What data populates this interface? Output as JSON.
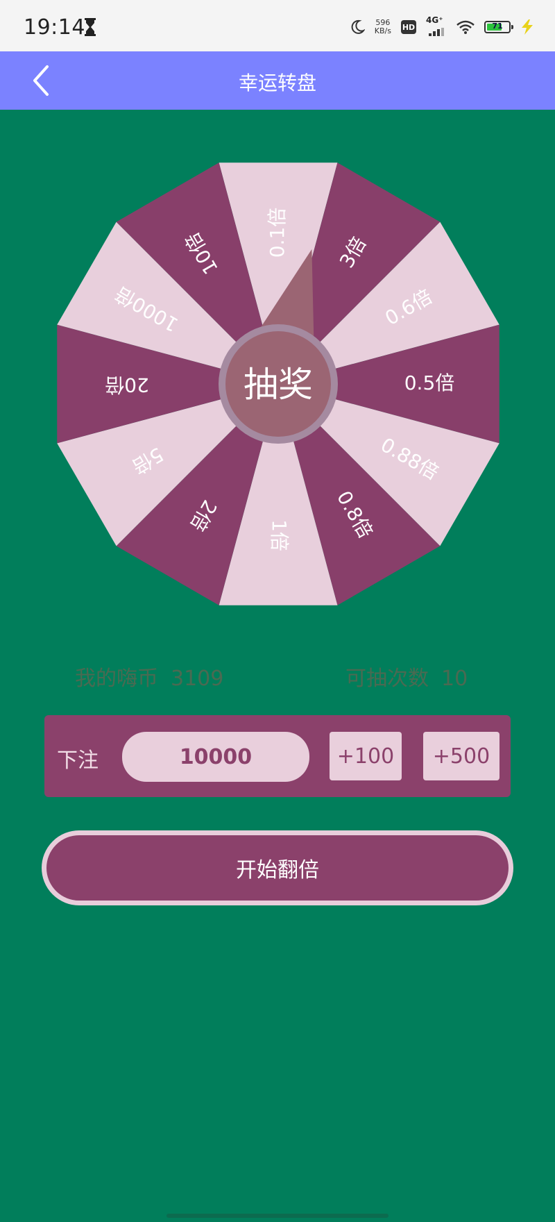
{
  "status_bar": {
    "time": "19:14",
    "net_speed_value": "596",
    "net_speed_unit": "KB/s",
    "hd": "HD",
    "network": "4G⁺",
    "battery": "71",
    "battery_level": 0.71
  },
  "header": {
    "title": "幸运转盘",
    "back_icon": "chevron-left-icon"
  },
  "wheel": {
    "segments": [
      "0.1倍",
      "3倍",
      "0.6倍",
      "0.5倍",
      "0.88倍",
      "0.8倍",
      "1倍",
      "2倍",
      "5倍",
      "20倍",
      "1000倍",
      "10倍"
    ],
    "center_label": "抽奖",
    "colors": {
      "dark": "#883f6a",
      "light": "#e8cfdc",
      "pointer": "#9b6573",
      "center": "#9b6573",
      "center_ring": "#a58aa0"
    }
  },
  "info": {
    "coins_label": "我的嗨币",
    "coins_value": "3109",
    "times_label": "可抽次数",
    "times_value": "10"
  },
  "bet": {
    "label": "下注",
    "value": "10000",
    "add_100": "+100",
    "add_500": "+500"
  },
  "start_button": "开始翻倍",
  "colors": {
    "background": "#017e5b",
    "header": "#7b82ff",
    "accent": "#8b416b"
  }
}
